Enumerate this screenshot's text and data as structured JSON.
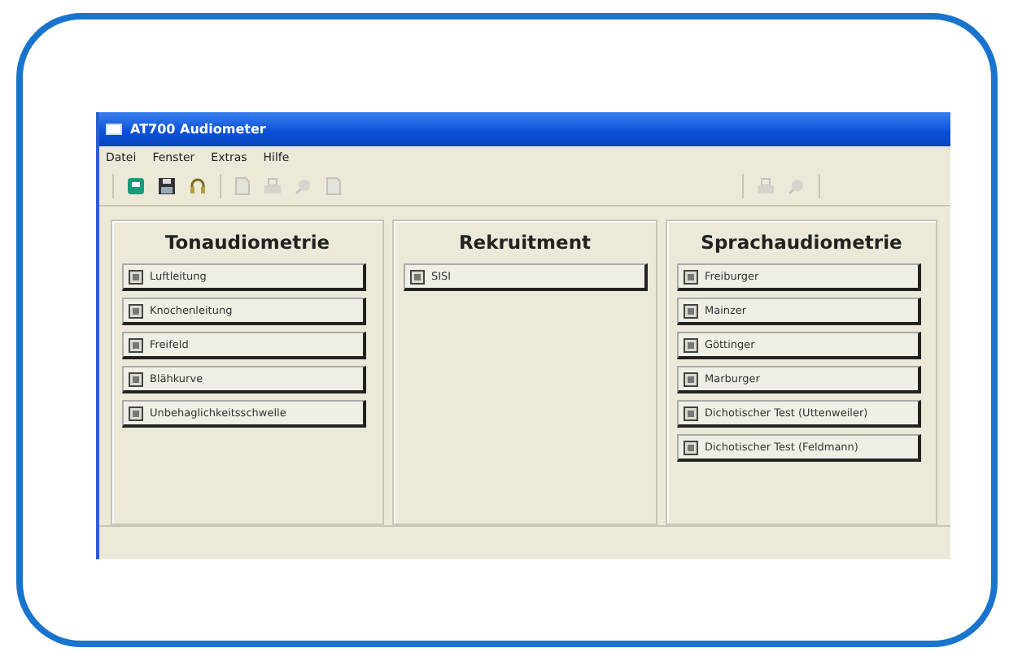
{
  "window": {
    "title": "AT700 Audiometer"
  },
  "menu": [
    "Datei",
    "Fenster",
    "Extras",
    "Hilfe"
  ],
  "toolbar": [
    {
      "kind": "monitor",
      "disabled": false
    },
    {
      "kind": "save",
      "disabled": false
    },
    {
      "kind": "headphones",
      "disabled": false
    },
    {
      "kind": "page",
      "disabled": true
    },
    {
      "kind": "printer",
      "disabled": true
    },
    {
      "kind": "search",
      "disabled": true
    },
    {
      "kind": "page",
      "disabled": true
    },
    {
      "kind": "printer",
      "disabled": true
    },
    {
      "kind": "search",
      "disabled": true
    }
  ],
  "panels": [
    {
      "title": "Tonaudiometrie",
      "buttons": [
        "Luftleitung",
        "Knochenleitung",
        "Freifeld",
        "Blähkurve",
        "Unbehaglichkeitsschwelle"
      ]
    },
    {
      "title": "Rekruitment",
      "buttons": [
        "SISI"
      ]
    },
    {
      "title": "Sprachaudiometrie",
      "buttons": [
        "Freiburger",
        "Mainzer",
        "Göttinger",
        "Marburger",
        "Dichotischer Test (Uttenweiler)",
        "Dichotischer Test (Feldmann)"
      ]
    }
  ]
}
